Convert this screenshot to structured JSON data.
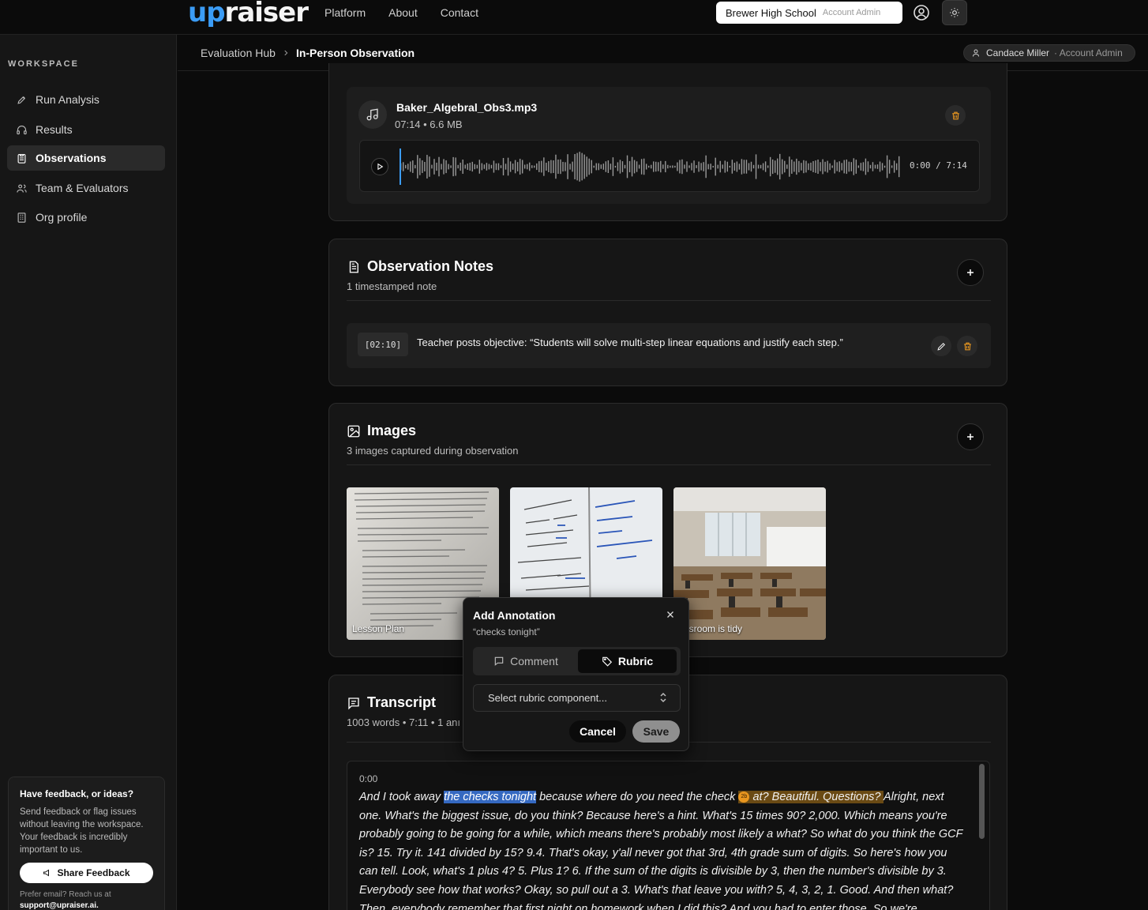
{
  "header": {
    "logo_up": "up",
    "logo_rest": "raiser",
    "nav": [
      "Platform",
      "About",
      "Contact"
    ],
    "school": "Brewer High School",
    "school_role": "Account Admin"
  },
  "sidebar": {
    "section_label": "WORKSPACE",
    "items": [
      {
        "label": "Run Analysis",
        "icon": "rocket-icon"
      },
      {
        "label": "Results",
        "icon": "headphones-icon"
      },
      {
        "label": "Observations",
        "icon": "clipboard-icon",
        "active": true
      },
      {
        "label": "Team & Evaluators",
        "icon": "users-icon"
      },
      {
        "label": "Org profile",
        "icon": "building-icon"
      }
    ],
    "feedback": {
      "title": "Have feedback, or ideas?",
      "body": "Send feedback or flag issues without leaving the workspace. Your feedback is incredibly important to us.",
      "button": "Share Feedback",
      "email_prefix": "Prefer email? Reach us at",
      "email": "support@upraiser.ai."
    }
  },
  "breadcrumb": {
    "parent": "Evaluation Hub",
    "current": "In-Person Observation",
    "user": "Candace Miller",
    "user_role": "· Account Admin"
  },
  "audio": {
    "file_name": "Baker_Algebral_Obs3.mp3",
    "meta": "07:14 • 6.6 MB",
    "time": "0:00 / 7:14",
    "progress": 0
  },
  "notes": {
    "title": "Observation Notes",
    "subtitle": "1 timestamped note",
    "items": [
      {
        "timestamp": "[02:10]",
        "text": "Teacher posts objective: “Students will solve multi-step linear equations and justify each step.”"
      }
    ]
  },
  "images": {
    "title": "Images",
    "subtitle": "3 images captured during observation",
    "items": [
      {
        "caption": "Lesson Plan"
      },
      {
        "caption": ""
      },
      {
        "caption": "assroom is tidy"
      }
    ]
  },
  "transcript": {
    "title": "Transcript",
    "subtitle": "1003 words • 7:11 • 1 anı",
    "start_time": "0:00",
    "text_pre": "And I took away ",
    "highlight_blue": "the checks tonight",
    "text_mid": " because where do you need the check ",
    "badge": "2b",
    "highlight_orange": "at? Beautiful. Questions? ",
    "text_post": "Alright, next one. What's the biggest issue, do you think? Because here's a hint. What's 15 times 90? 2,000. Which means you're probably going to be going for a while, which means there's probably most likely a what? So what do you think the GCF is? 15. Try it. 141 divided by 15? 9.4. That's okay, y'all never got that 3rd, 4th grade sum of digits. So here's how you can tell. Look, what's 1 plus 4? 5. Plus 1? 6. If the sum of the digits is divisible by 3, then the number's divisible by 3. Everybody see how that works? Okay, so pull out a 3. What's that leave you with? 5, 4, 3, 2, 1. Good. And then what? Then, everybody remember that first night on homework when I did this? And you had to enter those. So we're"
  },
  "annotation": {
    "title": "Add Annotation",
    "quote": "“checks tonight”",
    "tab_comment": "Comment",
    "tab_rubric": "Rubric",
    "active_tab": "Rubric",
    "select_placeholder": "Select rubric component...",
    "cancel": "Cancel",
    "save": "Save"
  },
  "colors": {
    "accent_blue": "#3b9cf5",
    "highlight_blue": "#3569c1",
    "highlight_orange": "#6a4a14",
    "trash_orange": "#e8961f"
  }
}
